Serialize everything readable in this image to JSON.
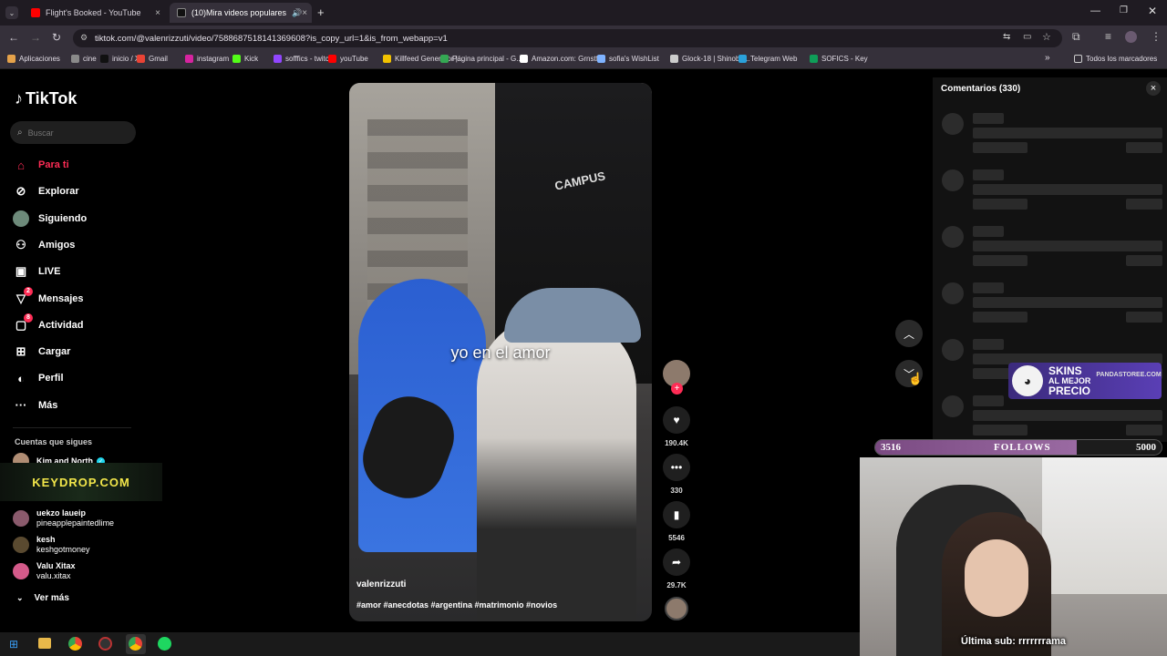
{
  "browser": {
    "tabs": [
      {
        "title": "Flight's Booked - YouTube",
        "color": "#ff0000"
      },
      {
        "title": "(10)Mira videos populares",
        "color": "#111111"
      }
    ],
    "new_tab": "+",
    "url": "tiktok.com/@valenrizzuti/video/7588687518141369608?is_copy_url=1&is_from_webapp=v1",
    "bookmarks": [
      {
        "label": "Aplicaciones",
        "color": "#e5a24a"
      },
      {
        "label": "cine",
        "color": "#8a8a8a"
      },
      {
        "label": "inicio / X",
        "color": "#111111"
      },
      {
        "label": "Gmail",
        "color": "#ea4335"
      },
      {
        "label": "instagram",
        "color": "#d6249f"
      },
      {
        "label": "Kick",
        "color": "#53fc18"
      },
      {
        "label": "sofffics - twitch",
        "color": "#9146ff"
      },
      {
        "label": "youTube",
        "color": "#ff0000"
      },
      {
        "label": "Killfeed Generator |...",
        "color": "#f2c200"
      },
      {
        "label": "Página principal - G...",
        "color": "#34a853"
      },
      {
        "label": "Amazon.com: Grnstf...",
        "color": "#ffffff"
      },
      {
        "label": "sofia's WishList",
        "color": "#7fb3ff"
      },
      {
        "label": "Glock-18 | Shinobu...",
        "color": "#cccccc"
      },
      {
        "label": "Telegram Web",
        "color": "#2aa1da"
      },
      {
        "label": "SOFICS - Key",
        "color": "#0f9d58"
      }
    ],
    "more_bookmarks": "»",
    "all_bookmarks": "Todos los marcadores"
  },
  "tiktok": {
    "logo": "TikTok",
    "search_placeholder": "Buscar",
    "nav": [
      {
        "label": "Para ti",
        "icon": "home-icon",
        "selected": true
      },
      {
        "label": "Explorar",
        "icon": "compass-icon"
      },
      {
        "label": "Siguiendo",
        "icon": "avatar-icon"
      },
      {
        "label": "Amigos",
        "icon": "friends-icon"
      },
      {
        "label": "LIVE",
        "icon": "live-icon"
      },
      {
        "label": "Mensajes",
        "icon": "messages-icon",
        "badge": "2"
      },
      {
        "label": "Actividad",
        "icon": "activity-icon",
        "badge": "8"
      },
      {
        "label": "Cargar",
        "icon": "upload-icon"
      },
      {
        "label": "Perfil",
        "icon": "profile-icon"
      },
      {
        "label": "Más",
        "icon": "more-icon"
      }
    ],
    "following_title": "Cuentas que sigues",
    "following": [
      {
        "name": "Kim and North",
        "verified": true
      },
      {
        "name": "uekzo laueip",
        "user": "pineapplepaintedlime"
      },
      {
        "name": "kesh",
        "user": "keshgotmoney"
      },
      {
        "name": "Valu Xitax",
        "user": "valu.xitax"
      }
    ],
    "see_more": "Ver más",
    "keydrop": "KEYDROP.COM"
  },
  "video": {
    "caption": "yo en el amor",
    "storefront_sign": "CAMPUS",
    "author": "valenrizzuti",
    "hashtags": "#amor #anecdotas #argentina #matrimonio #novios",
    "likes": "190.4K",
    "comments": "330",
    "saves": "5546",
    "shares": "29.7K"
  },
  "comments_panel": {
    "title": "Comentarios (330)",
    "close": "×"
  },
  "overlay": {
    "ad_line1": "SKINS",
    "ad_line2": "AL MEJOR",
    "ad_line3": "PRECIO",
    "ad_site": "PANDASTOREE.COM",
    "goal_current": "3516",
    "goal_label": "FOLLOWS",
    "goal_target": "5000",
    "goal_progress": 0.7032,
    "last_sub": "Última sub: rrrrrrrama"
  }
}
